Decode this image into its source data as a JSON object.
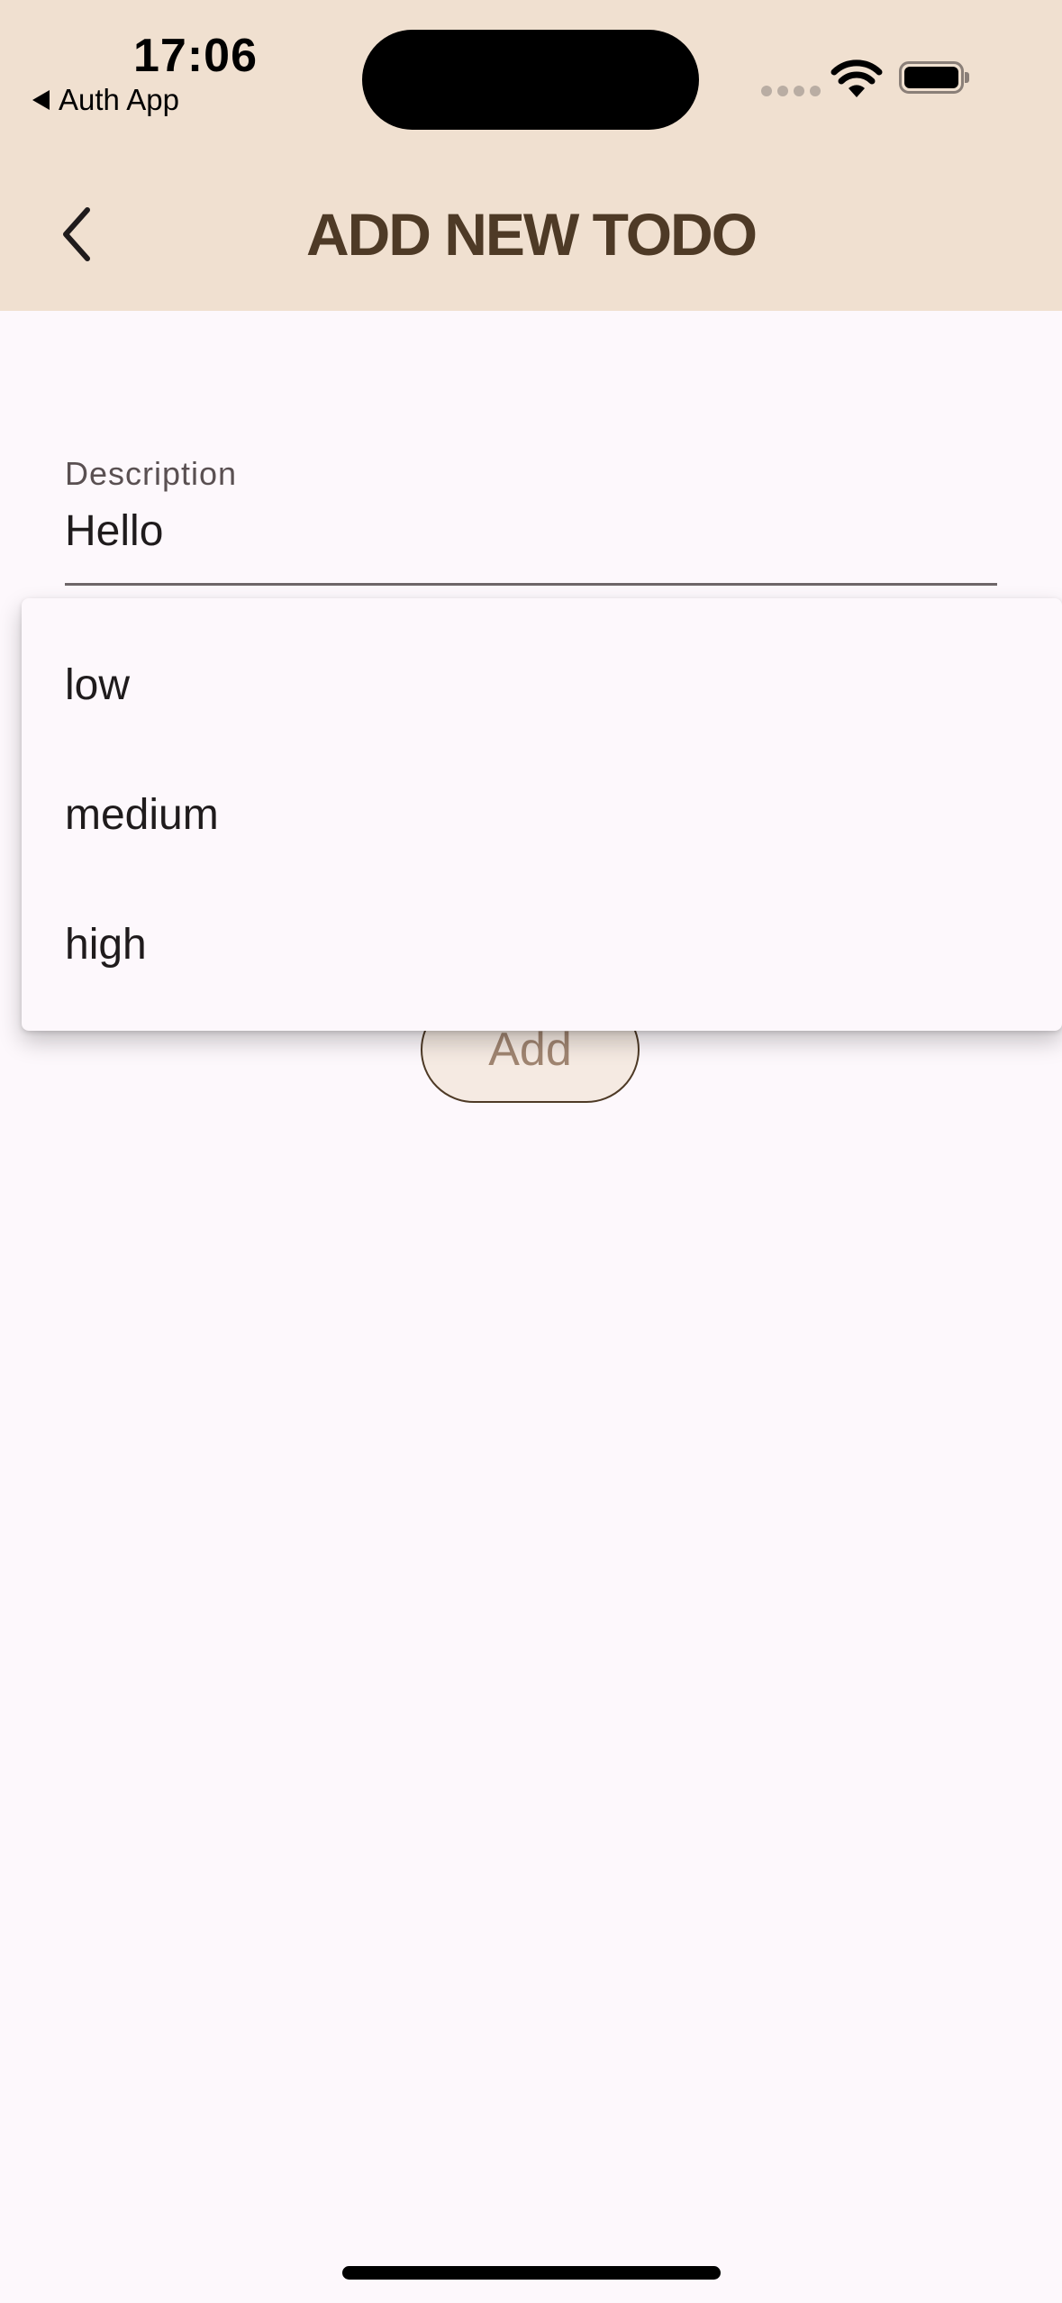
{
  "status_bar": {
    "time": "17:06",
    "back_app_label": "Auth App"
  },
  "header": {
    "title": "ADD NEW TODO"
  },
  "form": {
    "description_label": "Description",
    "description_value": "Hello",
    "add_label": "Add"
  },
  "dropdown": {
    "options": [
      "low",
      "medium",
      "high"
    ]
  },
  "icons": {
    "back": "chevron-left-icon",
    "wifi": "wifi-icon",
    "battery": "battery-icon"
  },
  "colors": {
    "header_bg": "#F0E0D0",
    "title_text": "#4E3A26",
    "page_bg": "#FDF8FC",
    "button_bg": "#F5EAE2",
    "button_text": "#A08571"
  }
}
